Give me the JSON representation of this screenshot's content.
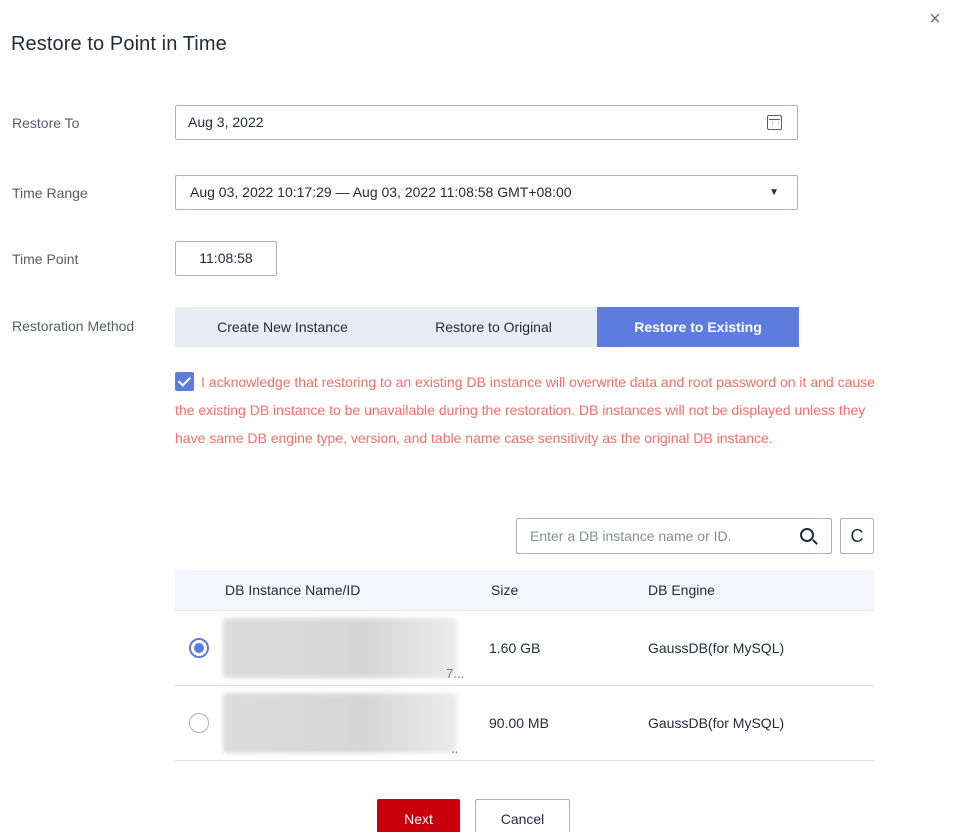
{
  "dialog": {
    "title": "Restore to Point in Time",
    "close_label": "×"
  },
  "form": {
    "restore_to": {
      "label": "Restore To",
      "value": "Aug 3, 2022"
    },
    "time_range": {
      "label": "Time Range",
      "value": "Aug 03, 2022 10:17:29 — Aug 03, 2022 11:08:58 GMT+08:00",
      "caret": "▼"
    },
    "time_point": {
      "label": "Time Point",
      "value": "11:08:58"
    },
    "restoration_method": {
      "label": "Restoration Method",
      "options": [
        "Create New Instance",
        "Restore to Original",
        "Restore to Existing"
      ],
      "selected": "Restore to Existing"
    },
    "acknowledge": {
      "checked": true,
      "text": "I acknowledge that restoring to an existing DB instance will overwrite data and root password on it and cause the existing DB instance to be unavailable during the restoration. DB instances will not be displayed unless they have same DB engine type, version, and table name case sensitivity as the original DB instance."
    }
  },
  "search": {
    "placeholder": "Enter a DB instance name or ID.",
    "refresh_glyph": "C"
  },
  "table": {
    "headers": [
      "DB Instance Name/ID",
      "Size",
      "DB Engine"
    ],
    "rows": [
      {
        "selected": true,
        "name_suffix": "7...",
        "size": "1.60 GB",
        "engine": "GaussDB(for MySQL)"
      },
      {
        "selected": false,
        "name_suffix": "..",
        "size": "90.00 MB",
        "engine": "GaussDB(for MySQL)"
      }
    ]
  },
  "footer": {
    "next_label": "Next",
    "cancel_label": "Cancel"
  },
  "colors": {
    "accent": "#5e7ce0",
    "primary_button": "#c7000b",
    "warning_text": "#f66f6a"
  }
}
